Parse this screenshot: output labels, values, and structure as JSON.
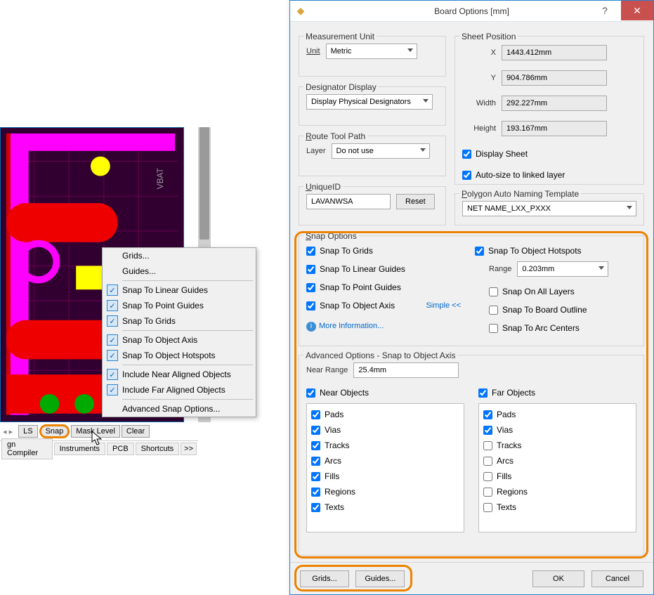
{
  "editor": {
    "popup": {
      "items": [
        {
          "label": "Grids...",
          "checked": false
        },
        {
          "label": "Guides...",
          "checked": false
        },
        {
          "sep": true
        },
        {
          "label": "Snap To Linear Guides",
          "checked": true
        },
        {
          "label": "Snap To Point Guides",
          "checked": true
        },
        {
          "label": "Snap To Grids",
          "checked": true
        },
        {
          "sep": true
        },
        {
          "label": "Snap To Object Axis",
          "checked": true
        },
        {
          "label": "Snap To Object Hotspots",
          "checked": true
        },
        {
          "sep": true
        },
        {
          "label": "Include Near Aligned Objects",
          "checked": true
        },
        {
          "label": "Include Far Aligned Objects",
          "checked": true
        },
        {
          "sep": true
        },
        {
          "label": "Advanced Snap Options...",
          "checked": false
        }
      ]
    },
    "bottom_tabs": {
      "ls": "LS",
      "snap": "Snap",
      "mask": "Mask Level",
      "clear": "Clear"
    },
    "foot_tabs": {
      "t1": "gn Compiler",
      "t2": "Instruments",
      "t3": "PCB",
      "t4": "Shortcuts",
      "more": ">>"
    }
  },
  "dialog": {
    "title": "Board Options [mm]",
    "measurement": {
      "legend": "Measurement Unit",
      "unit_label": "Unit",
      "unit_value": "Metric"
    },
    "designator": {
      "legend": "Designator Display",
      "value": "Display Physical Designators"
    },
    "route": {
      "legend": "Route Tool Path",
      "layer_label": "Layer",
      "value": "Do not use"
    },
    "uniqueid": {
      "legend": "UniqueID",
      "value": "LAVANWSA",
      "reset": "Reset"
    },
    "sheet": {
      "legend": "Sheet Position",
      "x_label": "X",
      "x": "1443.412mm",
      "y_label": "Y",
      "y": "904.786mm",
      "w_label": "Width",
      "w": "292.227mm",
      "h_label": "Height",
      "h": "193.167mm",
      "display": "Display Sheet",
      "autosize": "Auto-size to linked layer"
    },
    "polygon": {
      "legend": "Polygon Auto Naming Template",
      "value": "NET NAME_LXX_PXXX"
    },
    "snap": {
      "legend": "Snap Options",
      "to_grids": "Snap To Grids",
      "to_linear": "Snap To Linear Guides",
      "to_point": "Snap To Point Guides",
      "to_axis": "Snap To Object Axis",
      "simple": "Simple <<",
      "more": "More Information...",
      "to_hotspots": "Snap To Object Hotspots",
      "range_label": "Range",
      "range_value": "0.203mm",
      "all_layers": "Snap On All Layers",
      "board_outline": "Snap To Board Outline",
      "arc_centers": "Snap To Arc Centers"
    },
    "adv": {
      "legend": "Advanced Options - Snap to Object Axis",
      "near_range_label": "Near Range",
      "near_range": "25.4mm",
      "near_objects": "Near Objects",
      "far_objects": "Far Objects",
      "items": [
        "Pads",
        "Vias",
        "Tracks",
        "Arcs",
        "Fills",
        "Regions",
        "Texts"
      ],
      "far_checked": {
        "Pads": true,
        "Vias": true
      }
    },
    "foot": {
      "grids": "Grids...",
      "guides": "Guides...",
      "ok": "OK",
      "cancel": "Cancel"
    }
  }
}
